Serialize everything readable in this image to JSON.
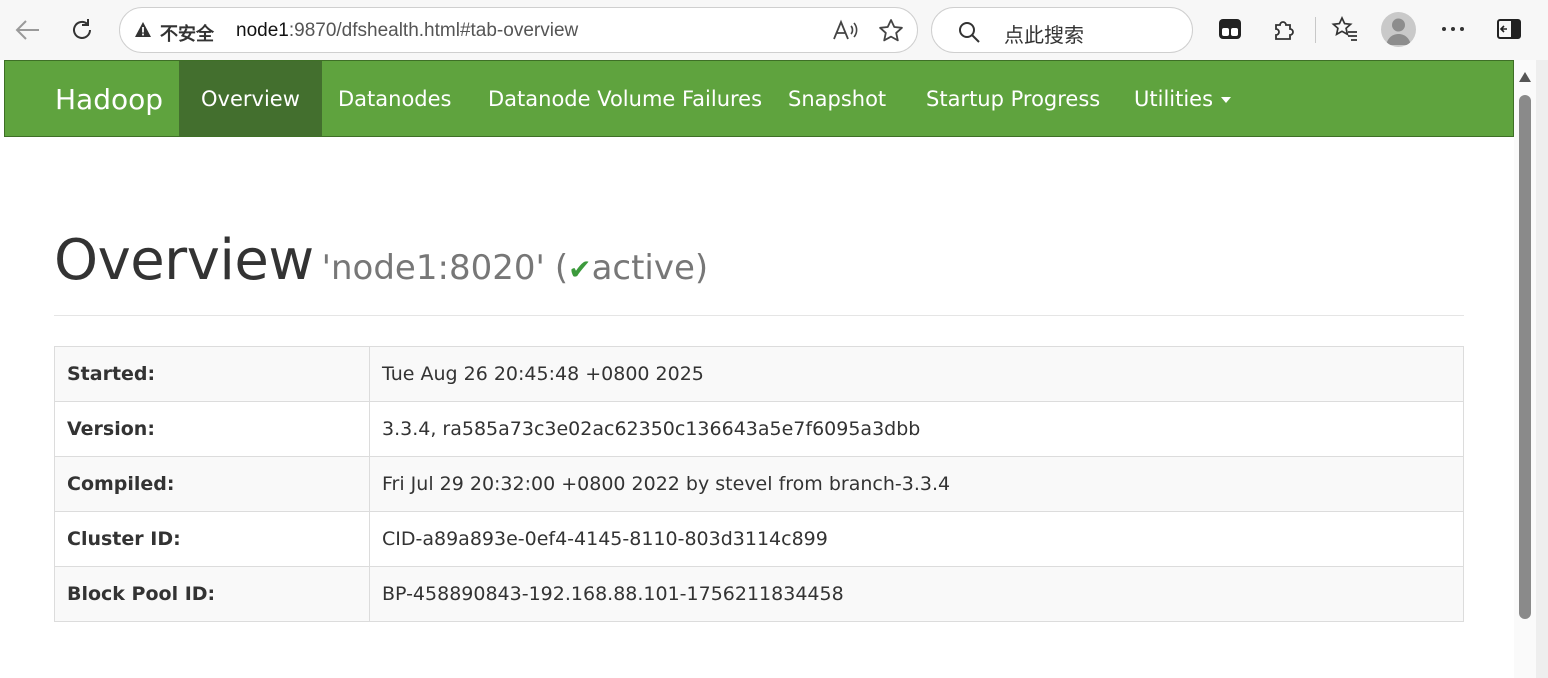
{
  "browser": {
    "security_label": "不安全",
    "url_host": "node1",
    "url_rest": ":9870/dfshealth.html#tab-overview",
    "search_placeholder": "点此搜索",
    "icons": [
      "back-icon",
      "refresh-icon",
      "warning-icon",
      "read-aloud-icon",
      "favorite-star-icon",
      "search-icon",
      "tab-actions-icon",
      "extensions-icon",
      "favorites-icon",
      "profile-avatar",
      "more-icon",
      "sidebar-icon"
    ]
  },
  "navbar": {
    "brand": "Hadoop",
    "items": [
      {
        "label": "Overview",
        "active": true
      },
      {
        "label": "Datanodes"
      },
      {
        "label": "Datanode Volume Failures"
      },
      {
        "label": "Snapshot"
      },
      {
        "label": "Startup Progress"
      },
      {
        "label": "Utilities"
      }
    ],
    "accent_color": "#5fa33e",
    "active_color": "#436f2e"
  },
  "overview": {
    "title": "Overview",
    "host": "'node1:8020'",
    "status_open": "(",
    "status": "active",
    "status_close": ")"
  },
  "info_table": [
    {
      "key": "Started:",
      "value": "Tue Aug 26 20:45:48 +0800 2025"
    },
    {
      "key": "Version:",
      "value": "3.3.4, ra585a73c3e02ac62350c136643a5e7f6095a3dbb"
    },
    {
      "key": "Compiled:",
      "value": "Fri Jul 29 20:32:00 +0800 2022 by stevel from branch-3.3.4"
    },
    {
      "key": "Cluster ID:",
      "value": "CID-a89a893e-0ef4-4145-8110-803d3114c899"
    },
    {
      "key": "Block Pool ID:",
      "value": "BP-458890843-192.168.88.101-1756211834458"
    }
  ]
}
